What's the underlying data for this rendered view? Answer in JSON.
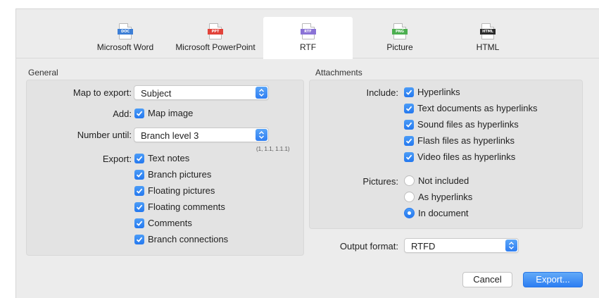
{
  "toolbar": {
    "items": [
      {
        "label": "Microsoft Word",
        "tag": "DOC",
        "color": "#3d7fd6",
        "icon": "word-doc-icon"
      },
      {
        "label": "Microsoft PowerPoint",
        "tag": "PPT",
        "color": "#e2433a",
        "icon": "powerpoint-doc-icon"
      },
      {
        "label": "RTF",
        "tag": "RTF",
        "color": "#8a73d6",
        "icon": "rtf-doc-icon",
        "selected": true
      },
      {
        "label": "Picture",
        "tag": "PNG",
        "color": "#4caf50",
        "icon": "png-doc-icon"
      },
      {
        "label": "HTML",
        "tag": "HTML",
        "color": "#2b2b2b",
        "icon": "html-doc-icon"
      }
    ]
  },
  "general": {
    "title": "General",
    "map_to_export_label": "Map to export:",
    "map_to_export_value": "Subject",
    "add_label": "Add:",
    "add_map_image": "Map image",
    "number_until_label": "Number until:",
    "number_until_value": "Branch level 3",
    "number_hint": "(1, 1.1, 1.1.1)",
    "export_label": "Export:",
    "export_options": [
      "Text notes",
      "Branch pictures",
      "Floating pictures",
      "Floating comments",
      "Comments",
      "Branch connections"
    ]
  },
  "attachments": {
    "title": "Attachments",
    "include_label": "Include:",
    "include_options": [
      "Hyperlinks",
      "Text documents as hyperlinks",
      "Sound files as hyperlinks",
      "Flash files as hyperlinks",
      "Video files as hyperlinks"
    ],
    "pictures_label": "Pictures:",
    "pictures_options": [
      "Not included",
      "As hyperlinks",
      "In document"
    ],
    "pictures_selected": "In document"
  },
  "output": {
    "label": "Output format:",
    "value": "RTFD"
  },
  "buttons": {
    "cancel": "Cancel",
    "export": "Export..."
  },
  "colors": {
    "accent": "#2f7ef2",
    "panel": "#e3e3e3",
    "window": "#ececec"
  }
}
